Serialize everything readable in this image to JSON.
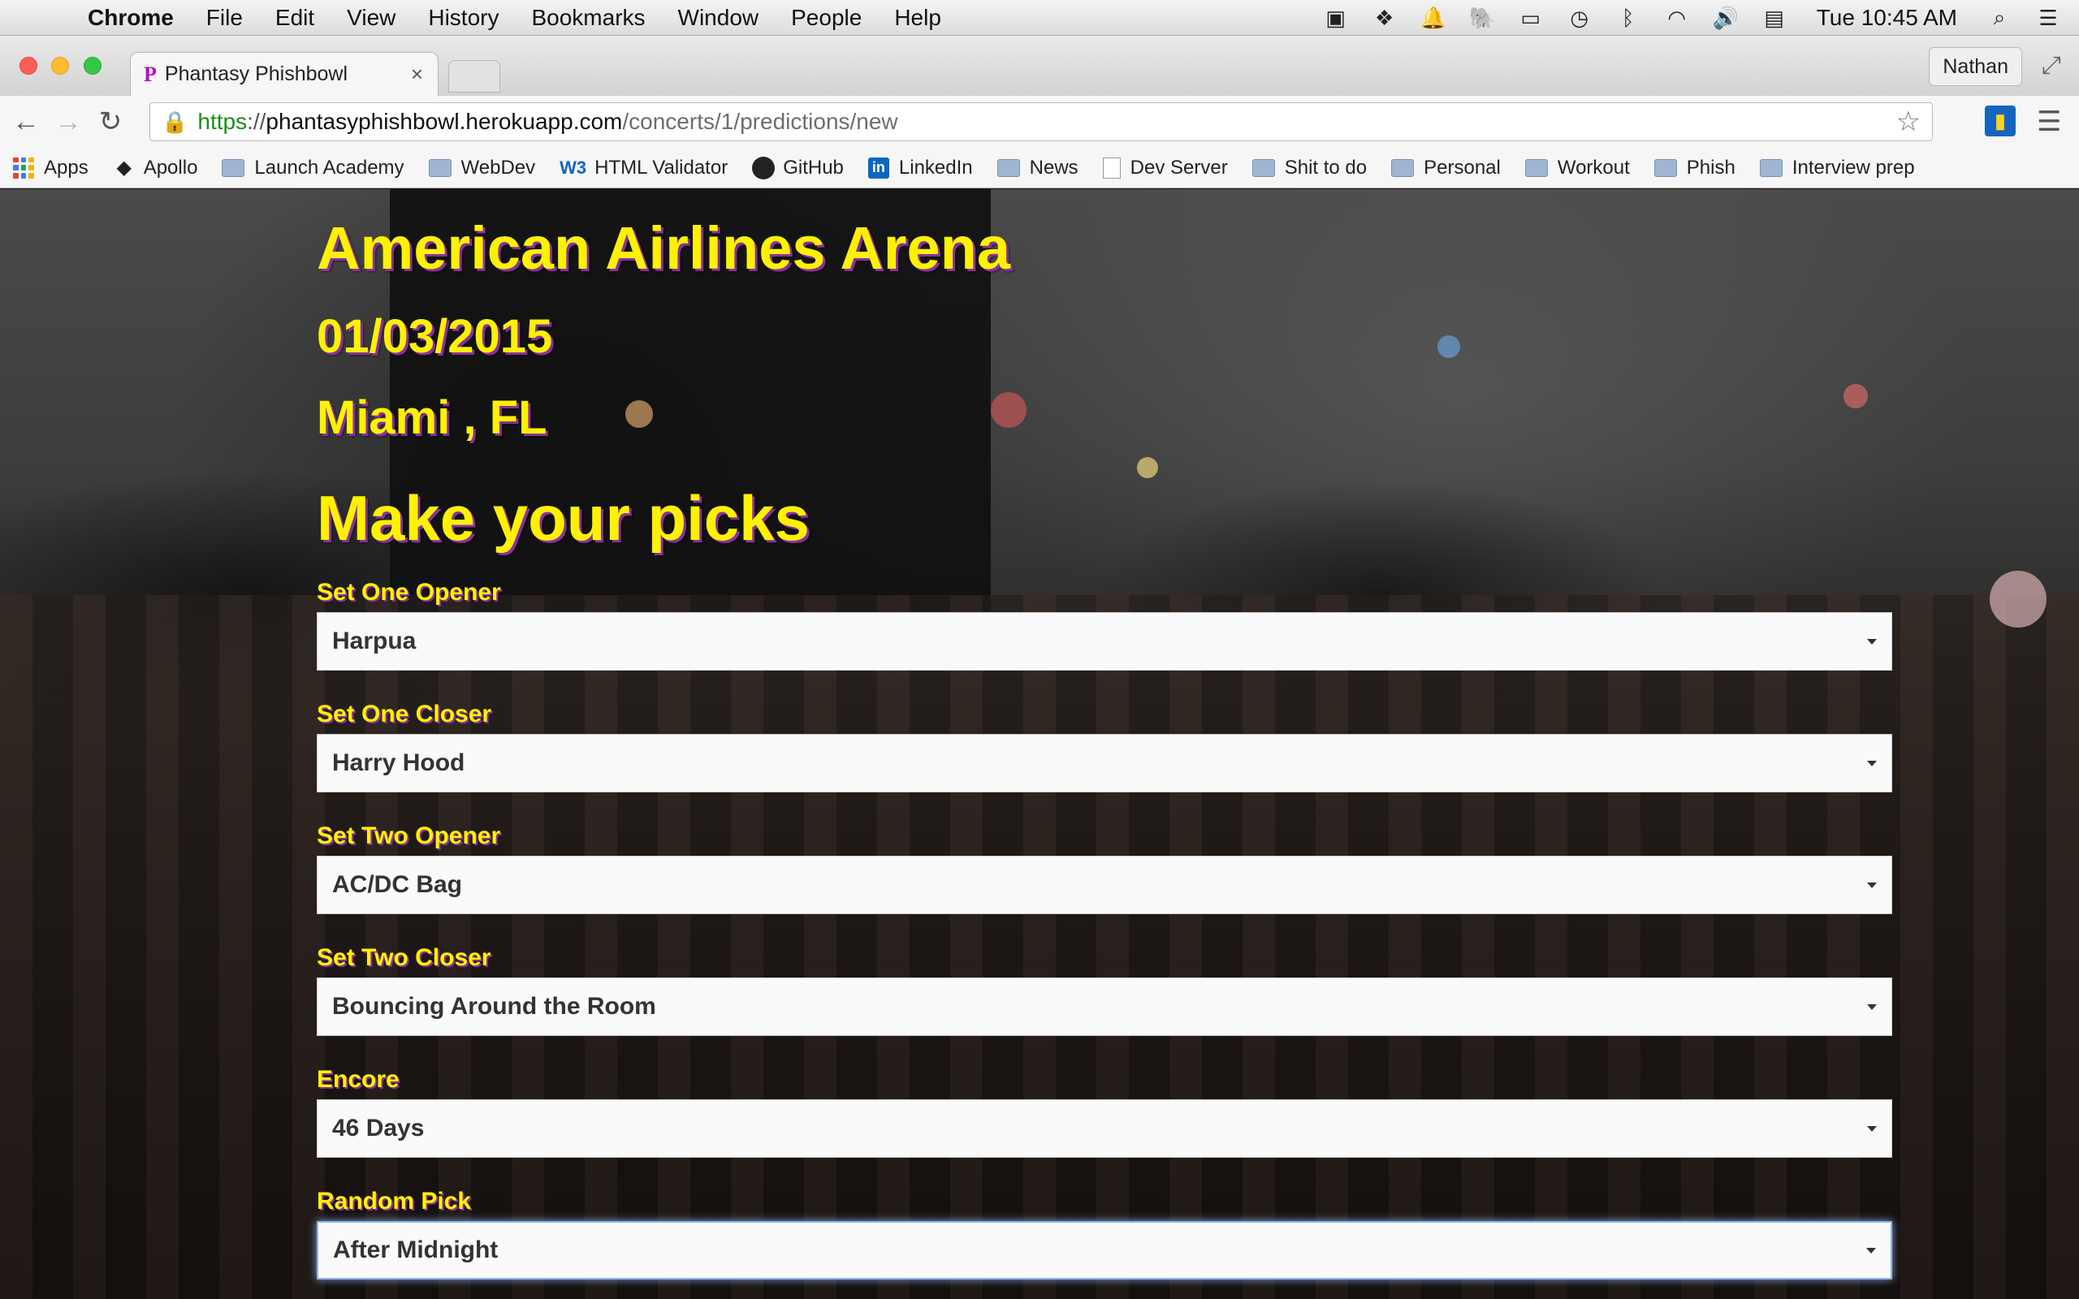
{
  "menubar": {
    "app": "Chrome",
    "items": [
      "File",
      "Edit",
      "View",
      "History",
      "Bookmarks",
      "Window",
      "People",
      "Help"
    ],
    "clock": "Tue 10:45 AM"
  },
  "browser": {
    "tab_title": "Phantasy Phishbowl",
    "tab_favicon": "P",
    "tab_close": "×",
    "profile": "Nathan",
    "url": {
      "scheme": "https",
      "sep": "://",
      "host": "phantasyphishbowl.herokuapp.com",
      "path": "/concerts/1/predictions/new"
    }
  },
  "bookmarks": [
    {
      "label": "Apps",
      "icon": "apps-grid-icon"
    },
    {
      "label": "Apollo",
      "icon": "apollo-icon"
    },
    {
      "label": "Launch Academy",
      "icon": "folder-icon"
    },
    {
      "label": "WebDev",
      "icon": "folder-icon"
    },
    {
      "label": "HTML Validator",
      "icon": "w3c-icon"
    },
    {
      "label": "GitHub",
      "icon": "github-icon"
    },
    {
      "label": "LinkedIn",
      "icon": "linkedin-icon"
    },
    {
      "label": "News",
      "icon": "folder-icon"
    },
    {
      "label": "Dev Server",
      "icon": "page-icon"
    },
    {
      "label": "Shit to do",
      "icon": "folder-icon"
    },
    {
      "label": "Personal",
      "icon": "folder-icon"
    },
    {
      "label": "Workout",
      "icon": "folder-icon"
    },
    {
      "label": "Phish",
      "icon": "folder-icon"
    },
    {
      "label": "Interview prep",
      "icon": "folder-icon"
    }
  ],
  "page": {
    "venue": "American Airlines Arena",
    "date": "01/03/2015",
    "city": "Miami , FL",
    "heading": "Make your picks",
    "fields": [
      {
        "label": "Set One Opener",
        "value": "Harpua"
      },
      {
        "label": "Set One Closer",
        "value": "Harry Hood"
      },
      {
        "label": "Set Two Opener",
        "value": "AC/DC Bag"
      },
      {
        "label": "Set Two Closer",
        "value": "Bouncing Around the Room"
      },
      {
        "label": "Encore",
        "value": "46 Days"
      },
      {
        "label": "Random Pick",
        "value": "After Midnight"
      }
    ]
  },
  "colors": {
    "title_yellow": "#fff200",
    "title_shadow": "#8b2fa0",
    "focus_ring": "#8fb4e6"
  }
}
